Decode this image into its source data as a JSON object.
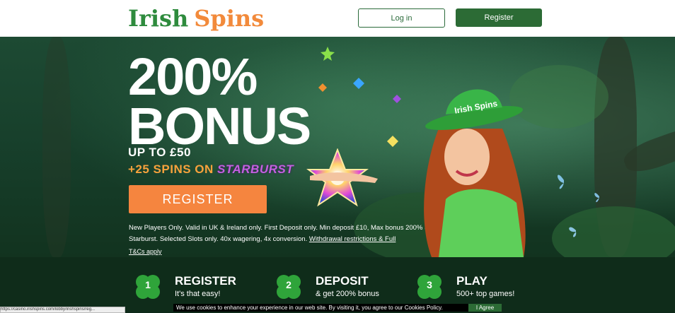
{
  "header": {
    "logo_word1": "Irish",
    "logo_word2": "Spins",
    "login_label": "Log in",
    "register_label": "Register"
  },
  "hero": {
    "headline_line1": "200%",
    "headline_line2": "BONUS",
    "upto": "UP TO £50",
    "spins_prefix": "+25 SPINS ON",
    "spins_brand": "STARBURST",
    "register_label": "REGISTER",
    "terms_text": "New Players Only. Valid in UK & Ireland only. First Deposit only. Min deposit £10, Max bonus 200% up to £50 + 25 Spins on Starburst. Selected Slots only. 40x wagering, 4x conversion.",
    "terms_link": "Withdrawal restrictions & Full",
    "tcs_link": "T&Cs apply",
    "hat_text": "Irish Spins"
  },
  "steps": [
    {
      "number": "1",
      "title": "REGISTER",
      "subtitle": "It's that easy!"
    },
    {
      "number": "2",
      "title": "DEPOSIT",
      "subtitle": "& get 200% bonus"
    },
    {
      "number": "3",
      "title": "PLAY",
      "subtitle": "500+ top games!"
    }
  ],
  "cookie": {
    "text": "We use cookies to enhance your experience in our web site. By visiting it, you agree to our Cookies Policy.",
    "agree_label": "I Agree"
  },
  "statusbar": {
    "url": "https://casino.irishspins.com/lobby/irishspins/reg..."
  },
  "colors": {
    "brand_green": "#2c6b35",
    "brand_orange": "#f5853f",
    "logo_green": "#2e8b3d",
    "logo_orange": "#f28a3b"
  }
}
